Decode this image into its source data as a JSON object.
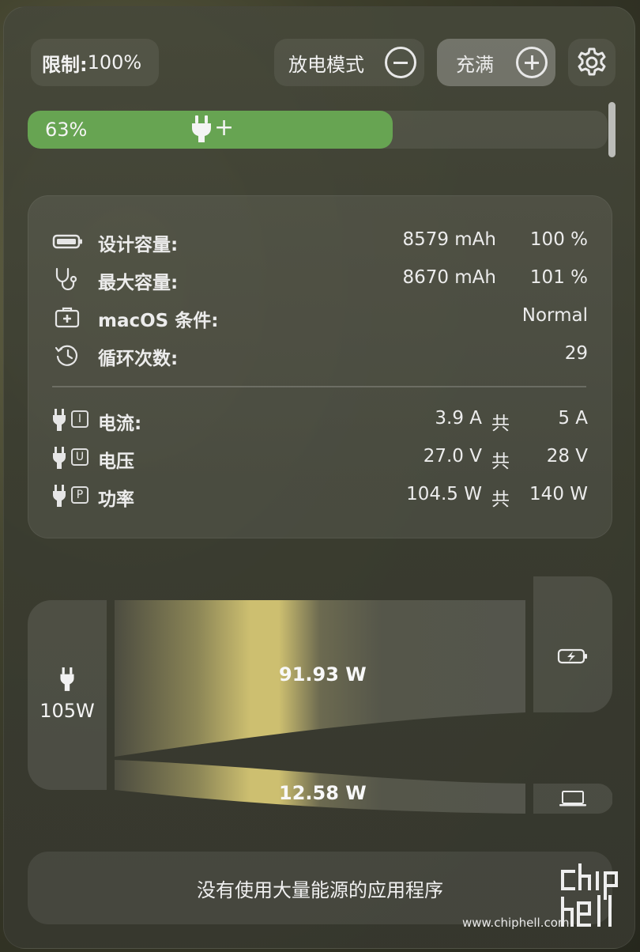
{
  "header": {
    "limit_label": "限制:",
    "limit_value": "100%",
    "discharge_label": "放电模式",
    "charge_label": "充满"
  },
  "battery": {
    "percent_text": "63%",
    "level": 0.63,
    "charging_symbol": "+"
  },
  "info": {
    "design_capacity": {
      "label": "设计容量:",
      "value": "8579 mAh",
      "pct": "100 %"
    },
    "max_capacity": {
      "label": "最大容量:",
      "value": "8670 mAh",
      "pct": "101 %"
    },
    "condition": {
      "label": "macOS 条件:",
      "value": "Normal"
    },
    "cycles": {
      "label": "循环次数:",
      "value": "29"
    },
    "current": {
      "letter": "I",
      "label": "电流:",
      "value": "3.9 A",
      "of": "共",
      "max": "5 A"
    },
    "voltage": {
      "letter": "U",
      "label": "电压",
      "value": "27.0 V",
      "of": "共",
      "max": "28 V"
    },
    "power": {
      "letter": "P",
      "label": "功率",
      "value": "104.5 W",
      "of": "共",
      "max": "140 W"
    }
  },
  "flow": {
    "source_value": "105W",
    "to_battery": "91.93 W",
    "to_system": "12.58 W"
  },
  "apps": {
    "message": "没有使用大量能源的应用程序"
  },
  "watermark": {
    "site": "www.chiphell.com"
  },
  "icons": {
    "plug": "plug-icon",
    "battery": "battery-icon",
    "stethoscope": "stethoscope-icon",
    "medkit": "medkit-icon",
    "history": "history-icon",
    "gear": "gear-icon",
    "laptop": "laptop-icon",
    "battery_charging": "battery-charging-icon"
  },
  "colors": {
    "battery_fill": "#67a452",
    "flow_highlight": "#cdbf70"
  }
}
